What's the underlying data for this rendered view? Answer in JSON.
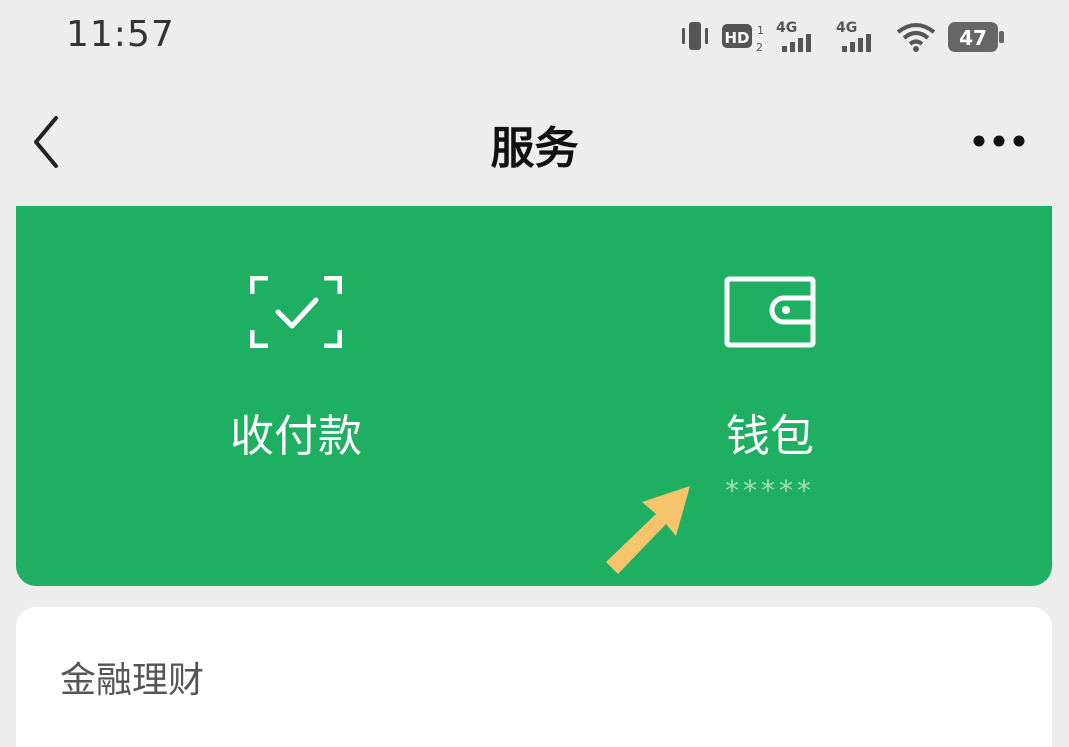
{
  "status_bar": {
    "time": "11:57",
    "hd_label": "HD",
    "sim_label": "4G",
    "battery": "47"
  },
  "nav": {
    "title": "服务"
  },
  "services": {
    "pay": {
      "label": "收付款",
      "icon": "scan-check-icon"
    },
    "wallet": {
      "label": "钱包",
      "balance": "*****",
      "icon": "wallet-icon"
    }
  },
  "sections": {
    "finance_title": "金融理财"
  },
  "colors": {
    "green": "#1faf63",
    "background": "#ededed",
    "arrow": "#f5c46b"
  }
}
